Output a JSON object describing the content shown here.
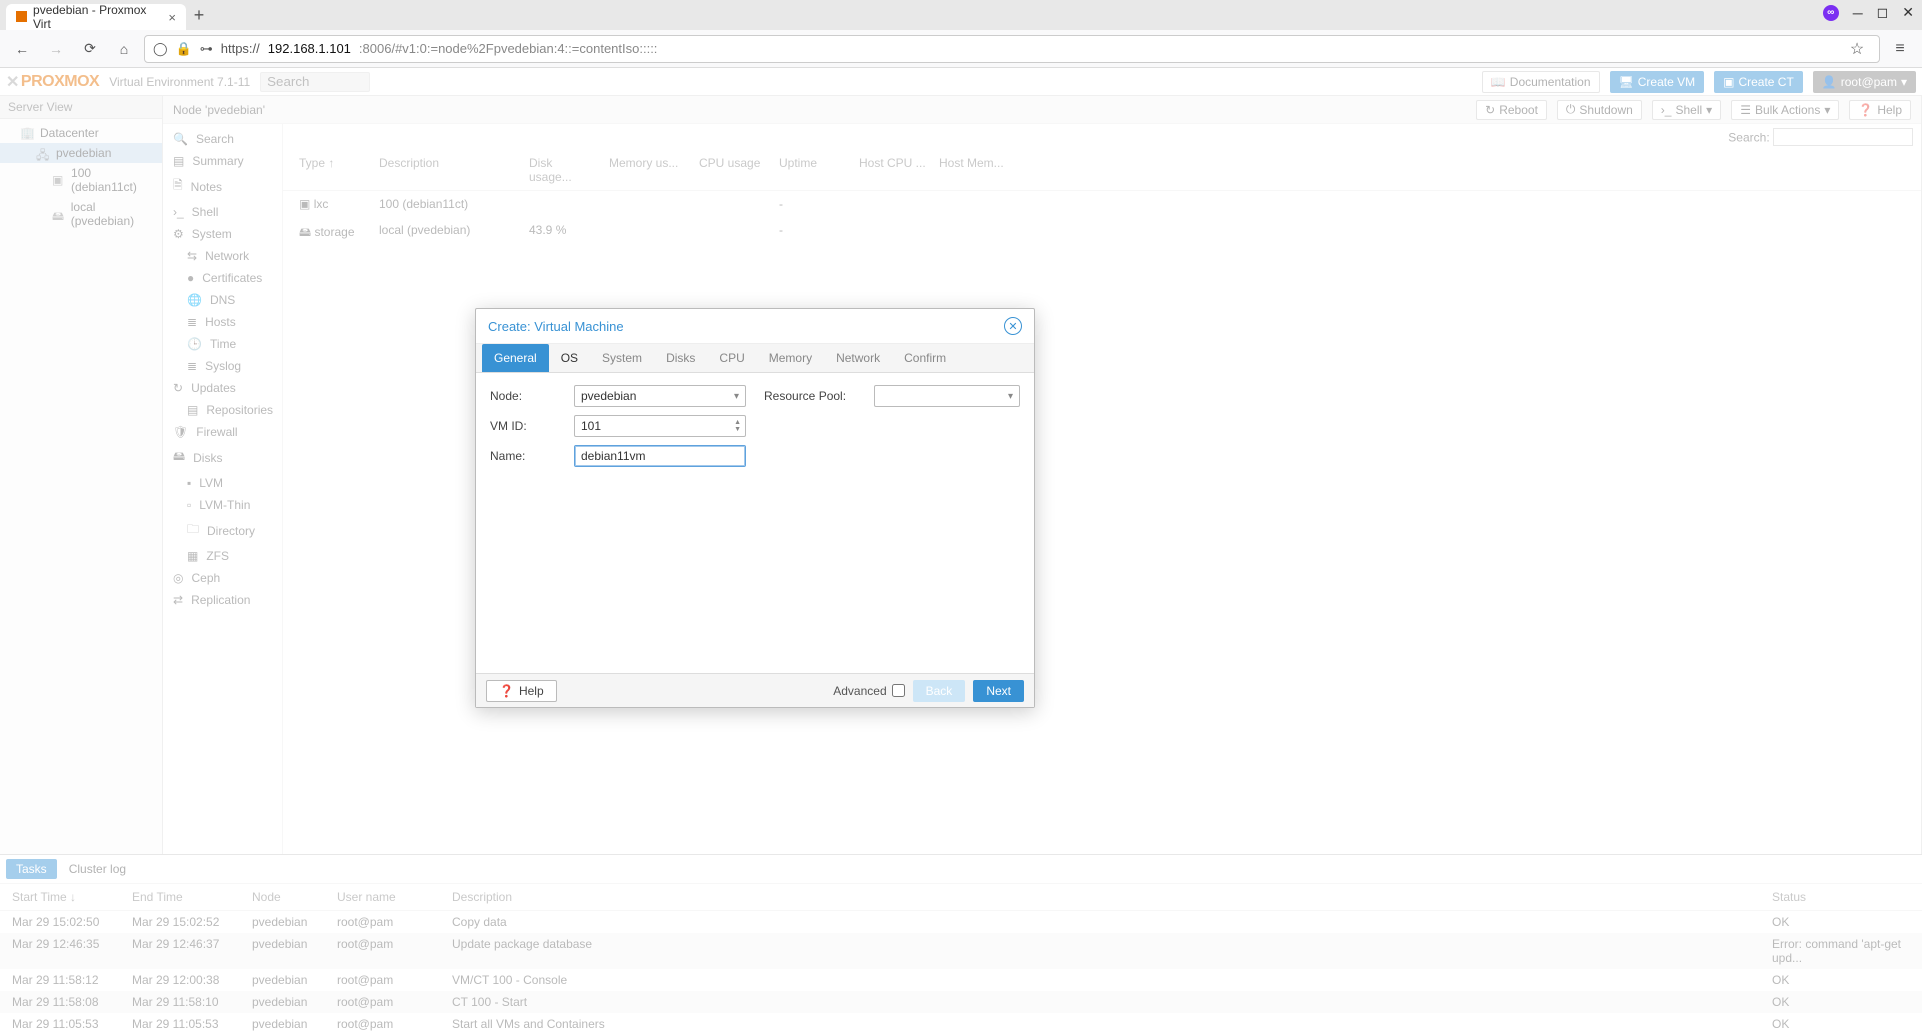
{
  "browser": {
    "tab_title": "pvedebian - Proxmox Virt",
    "url_prefix": "https://",
    "url_host": "192.168.1.101",
    "url_rest": ":8006/#v1:0:=node%2Fpvedebian:4::=contentIso:::::"
  },
  "topbar": {
    "product": "PROXMOX",
    "ve": "Virtual Environment 7.1-11",
    "search_placeholder": "Search",
    "doc": "Documentation",
    "create_vm": "Create VM",
    "create_ct": "Create CT",
    "user": "root@pam"
  },
  "leftnav": {
    "header": "Server View",
    "items": [
      "Datacenter",
      "pvedebian",
      "100 (debian11ct)",
      "local (pvedebian)"
    ]
  },
  "breadcrumb": {
    "title": "Node 'pvedebian'",
    "buttons": {
      "reboot": "Reboot",
      "shutdown": "Shutdown",
      "shell": "Shell",
      "bulk": "Bulk Actions",
      "help": "Help"
    }
  },
  "midnav": [
    "Search",
    "Summary",
    "Notes",
    "Shell",
    "System",
    "Network",
    "Certificates",
    "DNS",
    "Hosts",
    "Time",
    "Syslog",
    "Updates",
    "Repositories",
    "Firewall",
    "Disks",
    "LVM",
    "LVM-Thin",
    "Directory",
    "ZFS",
    "Ceph",
    "Replication"
  ],
  "table": {
    "search_label": "Search:",
    "headers": [
      "Type ↑",
      "Description",
      "Disk usage...",
      "Memory us...",
      "CPU usage",
      "Uptime",
      "Host CPU ...",
      "Host Mem..."
    ],
    "rows": [
      {
        "type": "lxc",
        "desc": "100 (debian11ct)",
        "disk": "",
        "uptime": "-"
      },
      {
        "type": "storage",
        "desc": "local (pvedebian)",
        "disk": "43.9 %",
        "uptime": "-"
      }
    ]
  },
  "tasks": {
    "tab_tasks": "Tasks",
    "tab_log": "Cluster log",
    "headers": {
      "start": "Start Time ↓",
      "end": "End Time",
      "node": "Node",
      "user": "User name",
      "desc": "Description",
      "status": "Status"
    },
    "rows": [
      {
        "st": "Mar 29 15:02:50",
        "et": "Mar 29 15:02:52",
        "node": "pvedebian",
        "user": "root@pam",
        "desc": "Copy data",
        "status": "OK"
      },
      {
        "st": "Mar 29 12:46:35",
        "et": "Mar 29 12:46:37",
        "node": "pvedebian",
        "user": "root@pam",
        "desc": "Update package database",
        "status": "Error: command 'apt-get upd..."
      },
      {
        "st": "Mar 29 11:58:12",
        "et": "Mar 29 12:00:38",
        "node": "pvedebian",
        "user": "root@pam",
        "desc": "VM/CT 100 - Console",
        "status": "OK"
      },
      {
        "st": "Mar 29 11:58:08",
        "et": "Mar 29 11:58:10",
        "node": "pvedebian",
        "user": "root@pam",
        "desc": "CT 100 - Start",
        "status": "OK"
      },
      {
        "st": "Mar 29 11:05:53",
        "et": "Mar 29 11:05:53",
        "node": "pvedebian",
        "user": "root@pam",
        "desc": "Start all VMs and Containers",
        "status": "OK"
      }
    ]
  },
  "modal": {
    "title": "Create: Virtual Machine",
    "tabs": [
      "General",
      "OS",
      "System",
      "Disks",
      "CPU",
      "Memory",
      "Network",
      "Confirm"
    ],
    "fields": {
      "node_label": "Node:",
      "node_value": "pvedebian",
      "vmid_label": "VM ID:",
      "vmid_value": "101",
      "name_label": "Name:",
      "name_value": "debian11vm",
      "pool_label": "Resource Pool:",
      "pool_value": ""
    },
    "footer": {
      "help": "Help",
      "advanced": "Advanced",
      "back": "Back",
      "next": "Next"
    }
  }
}
